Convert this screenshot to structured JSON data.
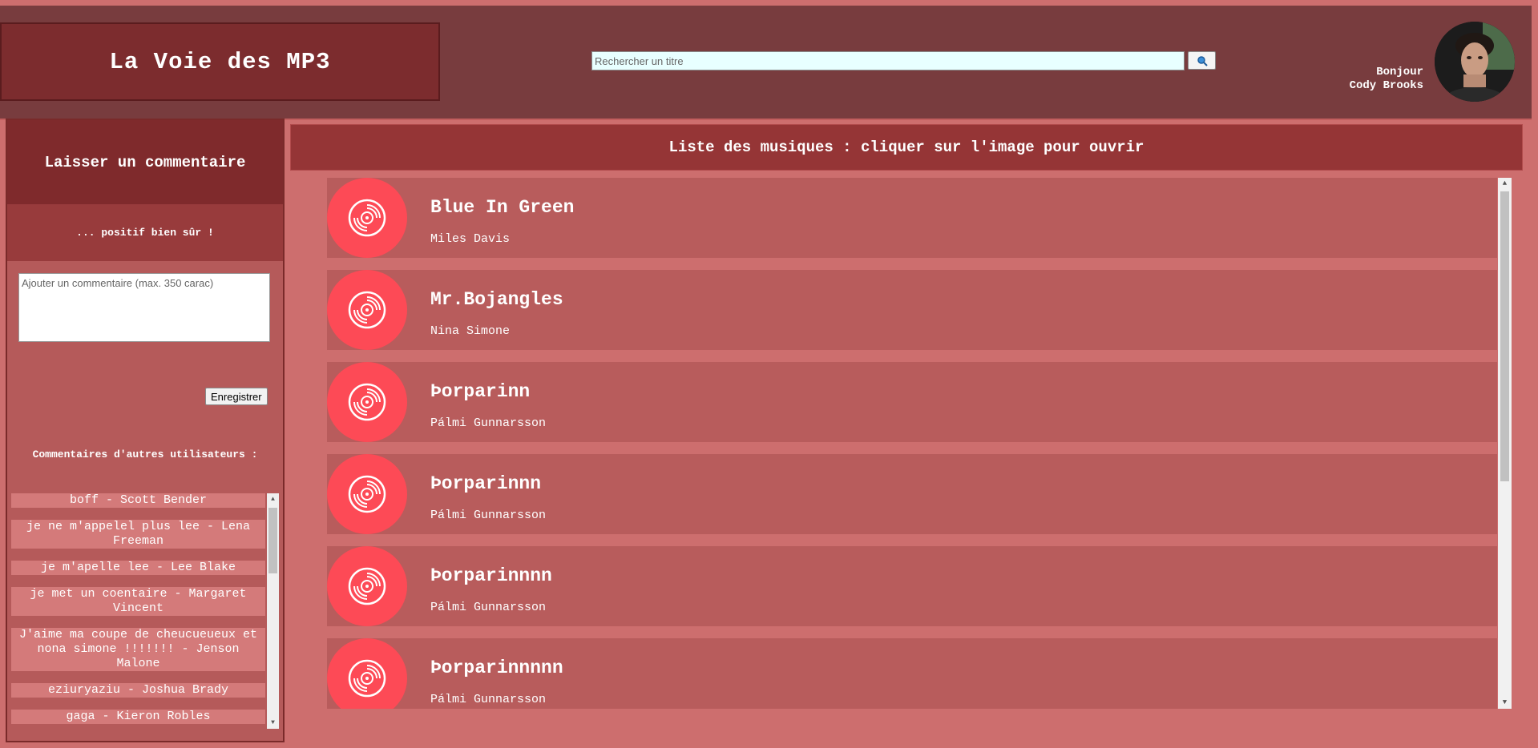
{
  "header": {
    "app_title": "La Voie des MP3",
    "search_placeholder": "Rechercher un titre",
    "search_button_icon": "search-icon",
    "greeting_line1": "Bonjour",
    "user_name": "Cody Brooks"
  },
  "sidebar": {
    "title": "Laisser un commentaire",
    "subtitle": "... positif bien sûr !",
    "comment_placeholder": "Ajouter un commentaire (max. 350 carac)",
    "save_label": "Enregistrer",
    "others_title": "Commentaires d'autres utilisateurs :",
    "comments": [
      "boff - Scott Bender",
      "je ne m'appelel plus lee - Lena Freeman",
      "je m'apelle lee - Lee Blake",
      "je met un coentaire - Margaret Vincent",
      "J'aime ma coupe de cheucueueux et nona simone !!!!!!! - Jenson Malone",
      "eziuryaziu - Joshua Brady",
      "gaga - Kieron Robles"
    ]
  },
  "main": {
    "list_title": "Liste des musiques : cliquer sur l'image pour ouvrir",
    "tracks": [
      {
        "title": "Blue In Green",
        "artist": "Miles Davis"
      },
      {
        "title": "Mr.Bojangles",
        "artist": "Nina Simone"
      },
      {
        "title": "Þorparinn",
        "artist": "Pálmi Gunnarsson"
      },
      {
        "title": "Þorparinnn",
        "artist": "Pálmi Gunnarsson"
      },
      {
        "title": "Þorparinnnn",
        "artist": "Pálmi Gunnarsson"
      },
      {
        "title": "Þorparinnnnn",
        "artist": "Pálmi Gunnarsson"
      }
    ]
  },
  "colors": {
    "page_bg": "#cd6e6e",
    "header_bg": "#783c3e",
    "accent_disc": "#fd4a56",
    "track_bar": "#b85c5c"
  }
}
